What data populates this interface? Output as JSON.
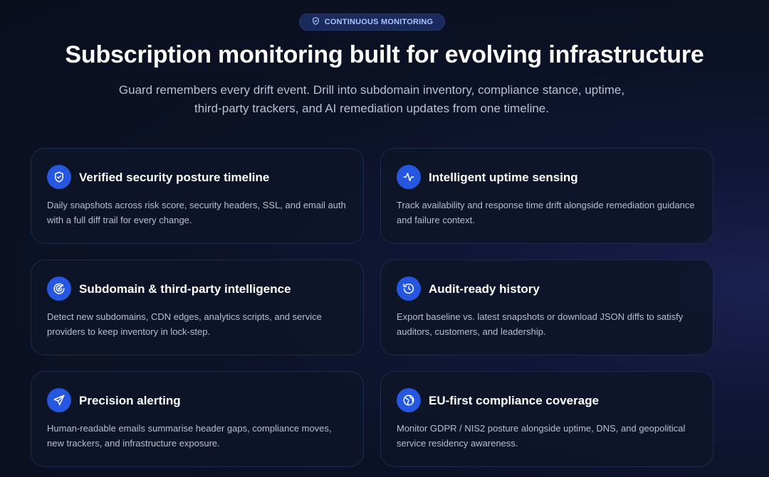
{
  "badge": {
    "label": "CONTINUOUS MONITORING",
    "icon": "shield-check-icon"
  },
  "header": {
    "title": "Subscription monitoring built for evolving infrastructure",
    "subtitle": "Guard remembers every drift event. Drill into subdomain inventory, compliance stance, uptime, third-party trackers, and AI remediation updates from one timeline."
  },
  "colors": {
    "accent": "#2557e0",
    "badge_bg": "#1a2a5c",
    "badge_text": "#a9c2ff"
  },
  "features": [
    {
      "icon": "shield-check-icon",
      "title": "Verified security posture timeline",
      "description": "Daily snapshots across risk score, security headers, SSL, and email auth with a full diff trail for every change."
    },
    {
      "icon": "activity-pulse-icon",
      "title": "Intelligent uptime sensing",
      "description": "Track availability and response time drift alongside remediation guidance and failure context."
    },
    {
      "icon": "radar-icon",
      "title": "Subdomain & third-party intelligence",
      "description": "Detect new subdomains, CDN edges, analytics scripts, and service providers to keep inventory in lock-step."
    },
    {
      "icon": "history-icon",
      "title": "Audit-ready history",
      "description": "Export baseline vs. latest snapshots or download JSON diffs to satisfy auditors, customers, and leadership."
    },
    {
      "icon": "send-icon",
      "title": "Precision alerting",
      "description": "Human-readable emails summarise header gaps, compliance moves, new trackers, and infrastructure exposure."
    },
    {
      "icon": "globe-icon",
      "title": "EU-first compliance coverage",
      "description": "Monitor GDPR / NIS2 posture alongside uptime, DNS, and geopolitical service residency awareness."
    }
  ]
}
